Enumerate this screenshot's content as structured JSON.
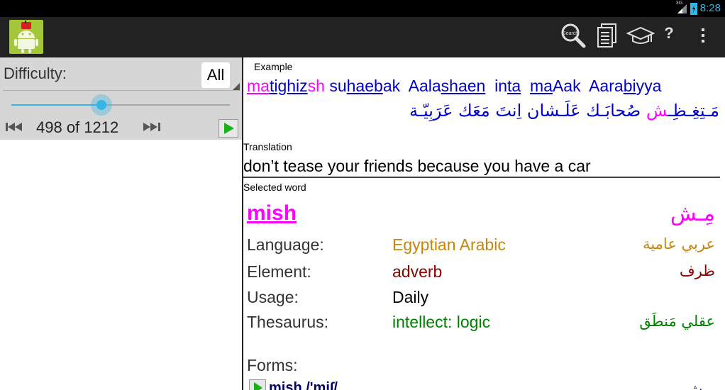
{
  "status_bar": {
    "network": "3G",
    "time": "8:28",
    "accent_color": "#33b5e5"
  },
  "action_bar": {
    "app_icon": "android-fez-icon",
    "actions": [
      {
        "icon": "search-icon",
        "label": "Search"
      },
      {
        "icon": "documents-icon",
        "label": ""
      },
      {
        "icon": "graduation-cap-icon",
        "label": ""
      },
      {
        "icon": "help-icon",
        "label": "?"
      },
      {
        "icon": "overflow-menu-icon",
        "label": ""
      }
    ]
  },
  "controls": {
    "difficulty_label": "Difficulty:",
    "difficulty_value": "All",
    "slider_fraction": 0.411,
    "counter": "498 of 1212"
  },
  "example": {
    "label": "Example",
    "latin_segments": [
      {
        "t": "ma",
        "c": "m",
        "u": true
      },
      {
        "t": "tighiz",
        "c": "b",
        "u": true
      },
      {
        "t": "sh",
        "c": "m",
        "u": false
      },
      {
        "t": " ",
        "c": "b",
        "u": false
      },
      {
        "t": "su",
        "c": "b",
        "u": false
      },
      {
        "t": "haeb",
        "c": "b",
        "u": true
      },
      {
        "t": "ak",
        "c": "b",
        "u": false
      },
      {
        "t": "  Aala",
        "c": "b",
        "u": false
      },
      {
        "t": "shaen",
        "c": "b",
        "u": true
      },
      {
        "t": "  in",
        "c": "b",
        "u": false
      },
      {
        "t": "ta",
        "c": "b",
        "u": true
      },
      {
        "t": "  ",
        "c": "b",
        "u": false
      },
      {
        "t": "ma",
        "c": "b",
        "u": true
      },
      {
        "t": "Aa",
        "c": "b",
        "u": false
      },
      {
        "t": "k  Aara",
        "c": "b",
        "u": false
      },
      {
        "t": "bi",
        "c": "b",
        "u": true
      },
      {
        "t": "yya",
        "c": "b",
        "u": false
      }
    ],
    "arabic_segments": [
      {
        "t": "مَـتِغِـظِـ",
        "c": "b"
      },
      {
        "t": "ش",
        "c": "m"
      },
      {
        "t": " صُحابَـك عَلَـشان اِنتَ مَعَك عَرَبِيّـة",
        "c": "b"
      }
    ]
  },
  "translation": {
    "label": "Translation",
    "text": "don’t tease your friends because you have a car"
  },
  "selected_word": {
    "label": "Selected word",
    "latin": "mish",
    "arabic": "مِـش",
    "rows": [
      {
        "key": "Language:",
        "value": "Egyptian Arabic",
        "arabic": "عربي عامية",
        "color": "#c8860a"
      },
      {
        "key": "Element:",
        "value": "adverb",
        "arabic": "ظرف",
        "color": "#8b0000"
      },
      {
        "key": "Usage:",
        "value": "Daily",
        "arabic": "",
        "color": "#000000"
      },
      {
        "key": "Thesaurus:",
        "value": "intellect: logic",
        "arabic": "عقلي مَنطَق",
        "color": "#008000"
      }
    ],
    "forms_label": "Forms:",
    "forms_entry": "mish /'mi∫/",
    "forms_arabic": "مِـش"
  },
  "colors": {
    "highlight": "#ff00ff",
    "example_text": "#0000cc",
    "app_icon_bg": "#a4c639"
  }
}
